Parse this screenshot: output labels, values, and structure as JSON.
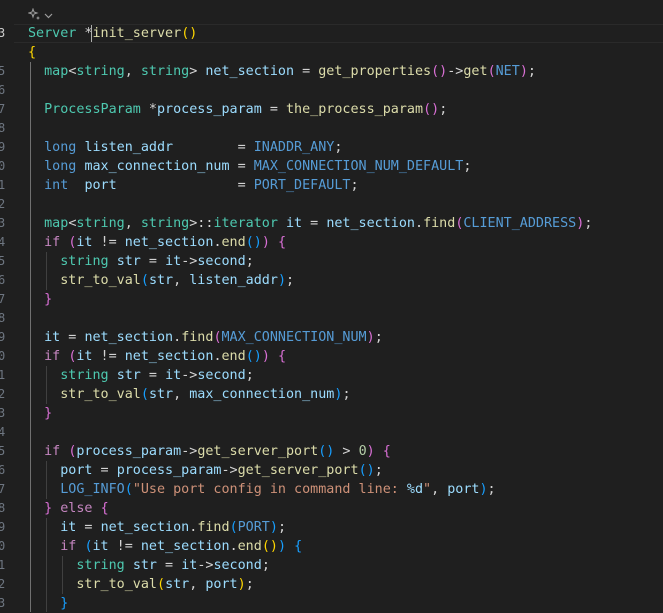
{
  "editor": {
    "codelens_icon": "sparkle-refactor-icon",
    "codelens_chevron": "chevron-down-icon",
    "line_number_digits": [
      "3",
      "",
      "5",
      "6",
      "7",
      "8",
      "9",
      "0",
      "1",
      "2",
      "3",
      "4",
      "5",
      "6",
      "7",
      "8",
      "9",
      "0",
      "1",
      "2",
      "3",
      "4",
      "5",
      "6",
      "7",
      "8",
      "9",
      "0",
      "1",
      "2",
      "3"
    ],
    "lines": [
      [
        {
          "t": "Server",
          "c": "ty"
        },
        {
          "t": " *",
          "c": "op"
        },
        {
          "t": "init_server",
          "c": "fn"
        },
        {
          "t": "()",
          "c": "b1"
        }
      ],
      [
        {
          "t": "{",
          "c": "b1"
        }
      ],
      [
        {
          "t": "  "
        },
        {
          "t": "map",
          "c": "ty"
        },
        {
          "t": "<",
          "c": "op"
        },
        {
          "t": "string",
          "c": "ty"
        },
        {
          "t": ", ",
          "c": "op"
        },
        {
          "t": "string",
          "c": "ty"
        },
        {
          "t": "> ",
          "c": "op"
        },
        {
          "t": "net_section",
          "c": "var"
        },
        {
          "t": " = ",
          "c": "op"
        },
        {
          "t": "get_properties",
          "c": "fn"
        },
        {
          "t": "()",
          "c": "b2"
        },
        {
          "t": "->",
          "c": "op"
        },
        {
          "t": "get",
          "c": "fn"
        },
        {
          "t": "(",
          "c": "b2"
        },
        {
          "t": "NET",
          "c": "mac"
        },
        {
          "t": ")",
          "c": "b2"
        },
        {
          "t": ";",
          "c": "op"
        }
      ],
      [],
      [
        {
          "t": "  "
        },
        {
          "t": "ProcessParam",
          "c": "ty"
        },
        {
          "t": " *",
          "c": "op"
        },
        {
          "t": "process_param",
          "c": "var"
        },
        {
          "t": " = ",
          "c": "op"
        },
        {
          "t": "the_process_param",
          "c": "fn"
        },
        {
          "t": "()",
          "c": "b2"
        },
        {
          "t": ";",
          "c": "op"
        }
      ],
      [],
      [
        {
          "t": "  "
        },
        {
          "t": "long",
          "c": "kw"
        },
        {
          "t": " "
        },
        {
          "t": "listen_addr",
          "c": "var"
        },
        {
          "t": "        = ",
          "c": "op"
        },
        {
          "t": "INADDR_ANY",
          "c": "mac"
        },
        {
          "t": ";",
          "c": "op"
        }
      ],
      [
        {
          "t": "  "
        },
        {
          "t": "long",
          "c": "kw"
        },
        {
          "t": " "
        },
        {
          "t": "max_connection_num",
          "c": "var"
        },
        {
          "t": " = ",
          "c": "op"
        },
        {
          "t": "MAX_CONNECTION_NUM_DEFAULT",
          "c": "mac"
        },
        {
          "t": ";",
          "c": "op"
        }
      ],
      [
        {
          "t": "  "
        },
        {
          "t": "int",
          "c": "kw"
        },
        {
          "t": "  "
        },
        {
          "t": "port",
          "c": "var"
        },
        {
          "t": "               = ",
          "c": "op"
        },
        {
          "t": "PORT_DEFAULT",
          "c": "mac"
        },
        {
          "t": ";",
          "c": "op"
        }
      ],
      [],
      [
        {
          "t": "  "
        },
        {
          "t": "map",
          "c": "ty"
        },
        {
          "t": "<",
          "c": "op"
        },
        {
          "t": "string",
          "c": "ty"
        },
        {
          "t": ", ",
          "c": "op"
        },
        {
          "t": "string",
          "c": "ty"
        },
        {
          "t": ">::",
          "c": "op"
        },
        {
          "t": "iterator",
          "c": "ty"
        },
        {
          "t": " "
        },
        {
          "t": "it",
          "c": "var"
        },
        {
          "t": " = ",
          "c": "op"
        },
        {
          "t": "net_section",
          "c": "var"
        },
        {
          "t": ".",
          "c": "op"
        },
        {
          "t": "find",
          "c": "fn"
        },
        {
          "t": "(",
          "c": "b2"
        },
        {
          "t": "CLIENT_ADDRESS",
          "c": "mac"
        },
        {
          "t": ")",
          "c": "b2"
        },
        {
          "t": ";",
          "c": "op"
        }
      ],
      [
        {
          "t": "  "
        },
        {
          "t": "if",
          "c": "ctl"
        },
        {
          "t": " "
        },
        {
          "t": "(",
          "c": "b2"
        },
        {
          "t": "it",
          "c": "var"
        },
        {
          "t": " != ",
          "c": "op"
        },
        {
          "t": "net_section",
          "c": "var"
        },
        {
          "t": ".",
          "c": "op"
        },
        {
          "t": "end",
          "c": "fn"
        },
        {
          "t": "()",
          "c": "b3"
        },
        {
          "t": ")",
          "c": "b2"
        },
        {
          "t": " "
        },
        {
          "t": "{",
          "c": "b2"
        }
      ],
      [
        {
          "t": "    "
        },
        {
          "t": "string",
          "c": "ty"
        },
        {
          "t": " "
        },
        {
          "t": "str",
          "c": "var"
        },
        {
          "t": " = ",
          "c": "op"
        },
        {
          "t": "it",
          "c": "var"
        },
        {
          "t": "->",
          "c": "op"
        },
        {
          "t": "second",
          "c": "var"
        },
        {
          "t": ";",
          "c": "op"
        }
      ],
      [
        {
          "t": "    "
        },
        {
          "t": "str_to_val",
          "c": "fn"
        },
        {
          "t": "(",
          "c": "b3"
        },
        {
          "t": "str",
          "c": "var"
        },
        {
          "t": ", ",
          "c": "op"
        },
        {
          "t": "listen_addr",
          "c": "var"
        },
        {
          "t": ")",
          "c": "b3"
        },
        {
          "t": ";",
          "c": "op"
        }
      ],
      [
        {
          "t": "  "
        },
        {
          "t": "}",
          "c": "b2"
        }
      ],
      [],
      [
        {
          "t": "  "
        },
        {
          "t": "it",
          "c": "var"
        },
        {
          "t": " = ",
          "c": "op"
        },
        {
          "t": "net_section",
          "c": "var"
        },
        {
          "t": ".",
          "c": "op"
        },
        {
          "t": "find",
          "c": "fn"
        },
        {
          "t": "(",
          "c": "b2"
        },
        {
          "t": "MAX_CONNECTION_NUM",
          "c": "mac"
        },
        {
          "t": ")",
          "c": "b2"
        },
        {
          "t": ";",
          "c": "op"
        }
      ],
      [
        {
          "t": "  "
        },
        {
          "t": "if",
          "c": "ctl"
        },
        {
          "t": " "
        },
        {
          "t": "(",
          "c": "b2"
        },
        {
          "t": "it",
          "c": "var"
        },
        {
          "t": " != ",
          "c": "op"
        },
        {
          "t": "net_section",
          "c": "var"
        },
        {
          "t": ".",
          "c": "op"
        },
        {
          "t": "end",
          "c": "fn"
        },
        {
          "t": "()",
          "c": "b3"
        },
        {
          "t": ")",
          "c": "b2"
        },
        {
          "t": " "
        },
        {
          "t": "{",
          "c": "b2"
        }
      ],
      [
        {
          "t": "    "
        },
        {
          "t": "string",
          "c": "ty"
        },
        {
          "t": " "
        },
        {
          "t": "str",
          "c": "var"
        },
        {
          "t": " = ",
          "c": "op"
        },
        {
          "t": "it",
          "c": "var"
        },
        {
          "t": "->",
          "c": "op"
        },
        {
          "t": "second",
          "c": "var"
        },
        {
          "t": ";",
          "c": "op"
        }
      ],
      [
        {
          "t": "    "
        },
        {
          "t": "str_to_val",
          "c": "fn"
        },
        {
          "t": "(",
          "c": "b3"
        },
        {
          "t": "str",
          "c": "var"
        },
        {
          "t": ", ",
          "c": "op"
        },
        {
          "t": "max_connection_num",
          "c": "var"
        },
        {
          "t": ")",
          "c": "b3"
        },
        {
          "t": ";",
          "c": "op"
        }
      ],
      [
        {
          "t": "  "
        },
        {
          "t": "}",
          "c": "b2"
        }
      ],
      [],
      [
        {
          "t": "  "
        },
        {
          "t": "if",
          "c": "ctl"
        },
        {
          "t": " "
        },
        {
          "t": "(",
          "c": "b2"
        },
        {
          "t": "process_param",
          "c": "var"
        },
        {
          "t": "->",
          "c": "op"
        },
        {
          "t": "get_server_port",
          "c": "fn"
        },
        {
          "t": "()",
          "c": "b3"
        },
        {
          "t": " > ",
          "c": "op"
        },
        {
          "t": "0",
          "c": "num"
        },
        {
          "t": ")",
          "c": "b2"
        },
        {
          "t": " "
        },
        {
          "t": "{",
          "c": "b2"
        }
      ],
      [
        {
          "t": "    "
        },
        {
          "t": "port",
          "c": "var"
        },
        {
          "t": " = ",
          "c": "op"
        },
        {
          "t": "process_param",
          "c": "var"
        },
        {
          "t": "->",
          "c": "op"
        },
        {
          "t": "get_server_port",
          "c": "fn"
        },
        {
          "t": "()",
          "c": "b3"
        },
        {
          "t": ";",
          "c": "op"
        }
      ],
      [
        {
          "t": "    "
        },
        {
          "t": "LOG_INFO",
          "c": "mac"
        },
        {
          "t": "(",
          "c": "b3"
        },
        {
          "t": "\"Use port config in command line: ",
          "c": "str"
        },
        {
          "t": "%d",
          "c": "esc"
        },
        {
          "t": "\"",
          "c": "str"
        },
        {
          "t": ", ",
          "c": "op"
        },
        {
          "t": "port",
          "c": "var"
        },
        {
          "t": ")",
          "c": "b3"
        },
        {
          "t": ";",
          "c": "op"
        }
      ],
      [
        {
          "t": "  "
        },
        {
          "t": "}",
          "c": "b2"
        },
        {
          "t": " "
        },
        {
          "t": "else",
          "c": "ctl"
        },
        {
          "t": " "
        },
        {
          "t": "{",
          "c": "b2"
        }
      ],
      [
        {
          "t": "    "
        },
        {
          "t": "it",
          "c": "var"
        },
        {
          "t": " = ",
          "c": "op"
        },
        {
          "t": "net_section",
          "c": "var"
        },
        {
          "t": ".",
          "c": "op"
        },
        {
          "t": "find",
          "c": "fn"
        },
        {
          "t": "(",
          "c": "b3"
        },
        {
          "t": "PORT",
          "c": "mac"
        },
        {
          "t": ")",
          "c": "b3"
        },
        {
          "t": ";",
          "c": "op"
        }
      ],
      [
        {
          "t": "    "
        },
        {
          "t": "if",
          "c": "ctl"
        },
        {
          "t": " "
        },
        {
          "t": "(",
          "c": "b3"
        },
        {
          "t": "it",
          "c": "var"
        },
        {
          "t": " != ",
          "c": "op"
        },
        {
          "t": "net_section",
          "c": "var"
        },
        {
          "t": ".",
          "c": "op"
        },
        {
          "t": "end",
          "c": "fn"
        },
        {
          "t": "()",
          "c": "b1"
        },
        {
          "t": ")",
          "c": "b3"
        },
        {
          "t": " "
        },
        {
          "t": "{",
          "c": "b3"
        }
      ],
      [
        {
          "t": "      "
        },
        {
          "t": "string",
          "c": "ty"
        },
        {
          "t": " "
        },
        {
          "t": "str",
          "c": "var"
        },
        {
          "t": " = ",
          "c": "op"
        },
        {
          "t": "it",
          "c": "var"
        },
        {
          "t": "->",
          "c": "op"
        },
        {
          "t": "second",
          "c": "var"
        },
        {
          "t": ";",
          "c": "op"
        }
      ],
      [
        {
          "t": "      "
        },
        {
          "t": "str_to_val",
          "c": "fn"
        },
        {
          "t": "(",
          "c": "b1"
        },
        {
          "t": "str",
          "c": "var"
        },
        {
          "t": ", ",
          "c": "op"
        },
        {
          "t": "port",
          "c": "var"
        },
        {
          "t": ")",
          "c": "b1"
        },
        {
          "t": ";",
          "c": "op"
        }
      ],
      [
        {
          "t": "    "
        },
        {
          "t": "}",
          "c": "b3"
        }
      ]
    ]
  }
}
